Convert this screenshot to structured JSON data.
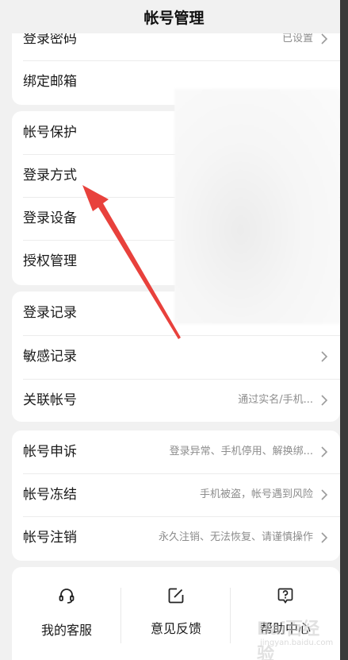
{
  "header": {
    "title": "帐号管理"
  },
  "card1": {
    "rows": [
      {
        "label": "登录密码",
        "value": "已设置"
      },
      {
        "label": "绑定邮箱",
        "value": ""
      }
    ]
  },
  "card2": {
    "rows": [
      {
        "label": "帐号保护"
      },
      {
        "label": "登录方式"
      },
      {
        "label": "登录设备"
      },
      {
        "label": "授权管理"
      }
    ]
  },
  "card3": {
    "rows": [
      {
        "label": "登录记录",
        "value": ""
      },
      {
        "label": "敏感记录",
        "value": ""
      },
      {
        "label": "关联帐号",
        "value": "通过实名/手机..."
      }
    ]
  },
  "card4": {
    "rows": [
      {
        "label": "帐号申诉",
        "value": "登录异常、手机停用、解换绑..."
      },
      {
        "label": "帐号冻结",
        "value": "手机被盗，帐号遇到风险"
      },
      {
        "label": "帐号注销",
        "value": "永久注销、无法恢复、请谨慎操作"
      }
    ]
  },
  "tools": [
    {
      "label": "我的客服",
      "icon": "headset-icon"
    },
    {
      "label": "意见反馈",
      "icon": "edit-icon"
    },
    {
      "label": "帮助中心",
      "icon": "help-icon"
    }
  ],
  "watermark": {
    "main": "Bai百经验",
    "sub": "jingyan.baidu.com"
  },
  "colors": {
    "background": "#f1f1f1",
    "card": "#ffffff",
    "annotation_arrow": "#e8413c",
    "secondary_text": "#8d8d8d"
  }
}
